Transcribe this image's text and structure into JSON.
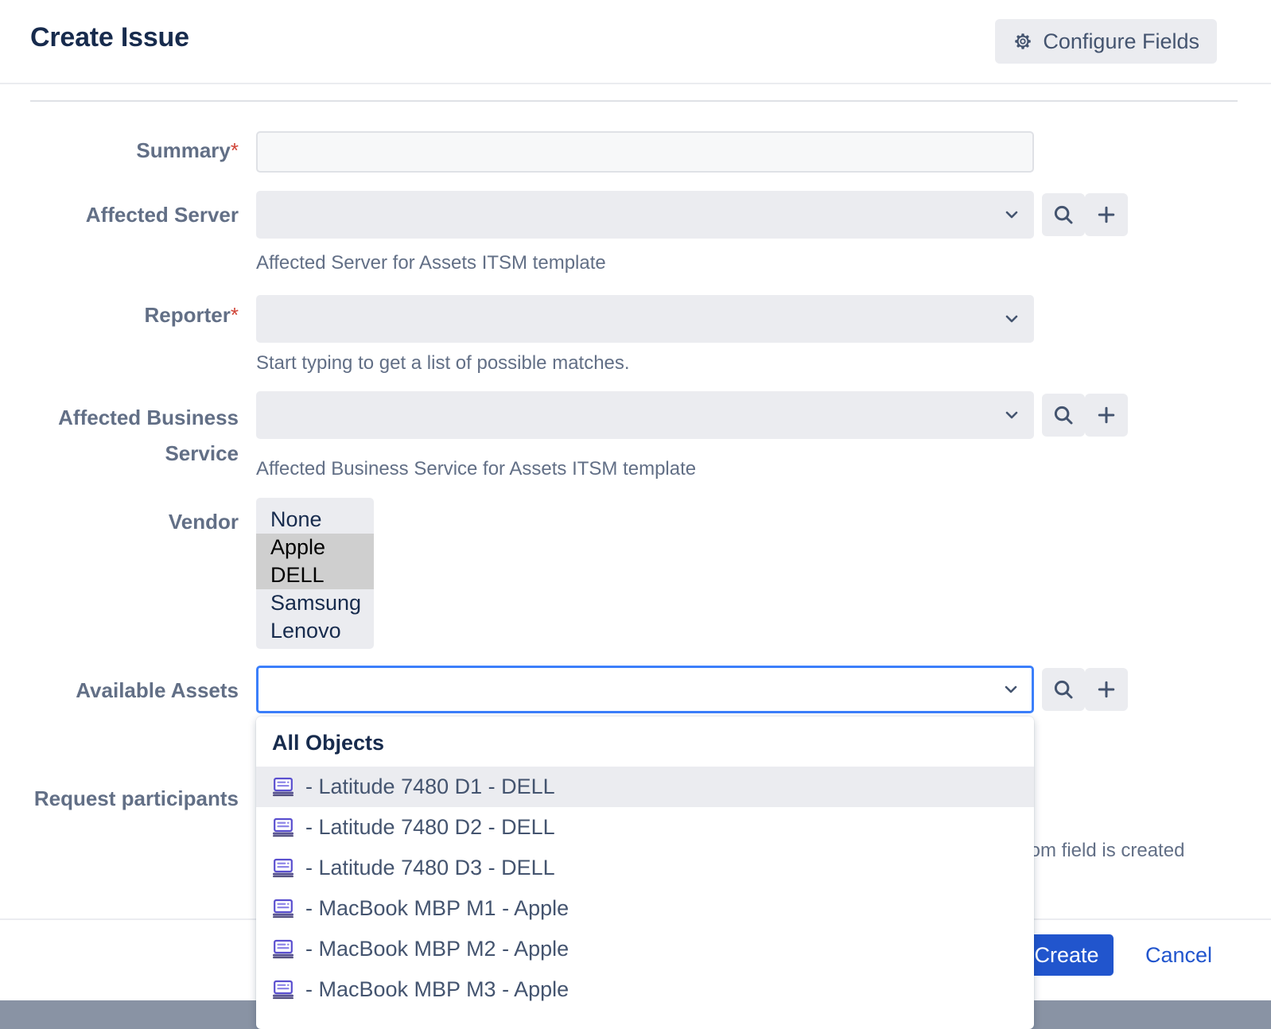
{
  "header": {
    "title": "Create Issue",
    "configure_fields_label": "Configure Fields",
    "gear_icon": "gear-icon"
  },
  "form": {
    "fields": [
      {
        "label": "Summary",
        "required": true,
        "value": "",
        "help": ""
      },
      {
        "label": "Affected Server",
        "required": false,
        "value": "",
        "help": "Affected Server for Assets ITSM template"
      },
      {
        "label": "Reporter",
        "required": true,
        "value": "",
        "help": "Start typing to get a list of possible matches."
      },
      {
        "label": "Affected Business Service",
        "required": false,
        "value": "",
        "help": "Affected Business Service for Assets ITSM template"
      },
      {
        "label": "Vendor",
        "required": false,
        "options": [
          "None",
          "Apple",
          "DELL",
          "Samsung",
          "Lenovo"
        ],
        "selected": [
          "Apple",
          "DELL"
        ],
        "help": ""
      },
      {
        "label": "Available Assets",
        "required": false,
        "value": "",
        "focused": true,
        "help": ""
      },
      {
        "label": "Request participants",
        "required": false,
        "value": "",
        "help": "tom field is created"
      }
    ],
    "icons": {
      "chevron": "chevron-down-icon",
      "search": "search-icon",
      "add": "plus-icon"
    }
  },
  "dropdown": {
    "group_title": "All Objects",
    "options": [
      {
        "icon": "laptop-icon",
        "label": "- Latitude 7480 D1 - DELL",
        "highlighted": true
      },
      {
        "icon": "laptop-icon",
        "label": "- Latitude 7480 D2 - DELL",
        "highlighted": false
      },
      {
        "icon": "laptop-icon",
        "label": "- Latitude 7480 D3 - DELL",
        "highlighted": false
      },
      {
        "icon": "laptop-icon",
        "label": "- MacBook MBP M1 - Apple",
        "highlighted": false
      },
      {
        "icon": "laptop-icon",
        "label": "- MacBook MBP M2 - Apple",
        "highlighted": false
      },
      {
        "icon": "laptop-icon",
        "label": "- MacBook MBP M3 - Apple",
        "highlighted": false
      }
    ]
  },
  "footer": {
    "create_label": "Create",
    "cancel_label": "Cancel"
  },
  "colors": {
    "primary_blue": "#2155cd",
    "focus_blue": "#3b7ffb",
    "label_grey": "#626f86",
    "title_navy": "#172b4d",
    "field_bg": "#ebecf0",
    "required_red": "#d04437",
    "icon_indigo": "#5a4fcf"
  }
}
